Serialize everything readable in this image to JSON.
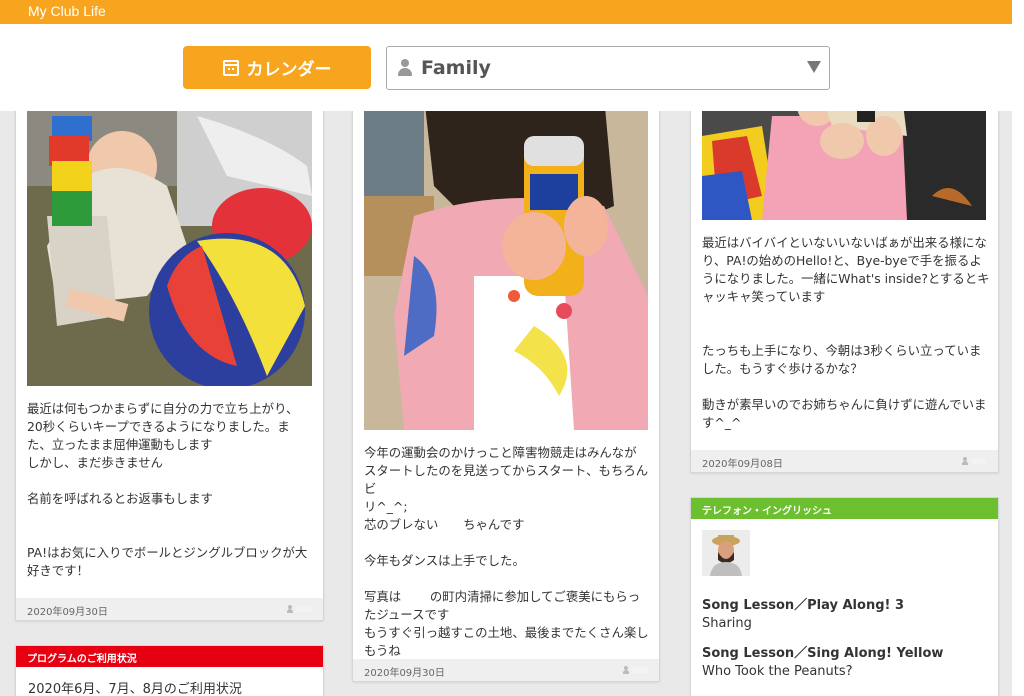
{
  "app": {
    "title": "My Club Life"
  },
  "controls": {
    "calendar_label": "カレンダー",
    "profile_select_value": "Family"
  },
  "posts": [
    {
      "text": "最近は何もつかまらずに自分の力で立ち上がり、\n20秒くらいキープできるようになりました。ま\nた、立ったまま屈伸運動もします\nしかし、まだ歩きません\n\n名前を呼ばれるとお返事もします\n\n\nPA!はお気に入りでボールとジングルブロックが大\n好きです！",
      "date": "2020年09月30日"
    },
    {
      "text": "今年の運動会のかけっこと障害物競走はみんなが\nスタートしたのを見送ってからスタート、もちろんビ\nリ^_^;\n芯のブレない　　ちゃんです\n\n今年もダンスは上手でした。\n\n写真は　　 の町内清掃に参加してご褒美にもらっ\nたジュースです\nもうすぐ引っ越すこの土地、最後までたくさん楽し\nもうね",
      "date": "2020年09月30日"
    },
    {
      "text": "最近はバイバイといないいないばぁが出来る様にな\nり、PA!の始めのHello!と、Bye-byeで手を振るよ\nうになりました。一緒にWhat's inside?とするとキ\nャッキャ笑っています\n\n\nたっちも上手になり、今朝は3秒くらい立っていま\nした。もうすぐ歩けるかな？\n\n動きが素早いのでお姉ちゃんに負けずに遊んでいま\nす^_^",
      "date": "2020年09月08日"
    }
  ],
  "program": {
    "header": "プログラムのご利用状況",
    "body": "2020年6月、7月、8月のご利用状況"
  },
  "telephone": {
    "header": "テレフォン・イングリッシュ",
    "lessons": [
      {
        "title": "Song Lesson／Play Along! 3",
        "subtitle": "Sharing"
      },
      {
        "title": "Song Lesson／Sing Along! Yellow",
        "subtitle": "Who Took the Peanuts?"
      }
    ]
  },
  "colors": {
    "brand_orange": "#f7a51e",
    "program_red": "#e60012",
    "telephone_green": "#6cbf2f"
  }
}
